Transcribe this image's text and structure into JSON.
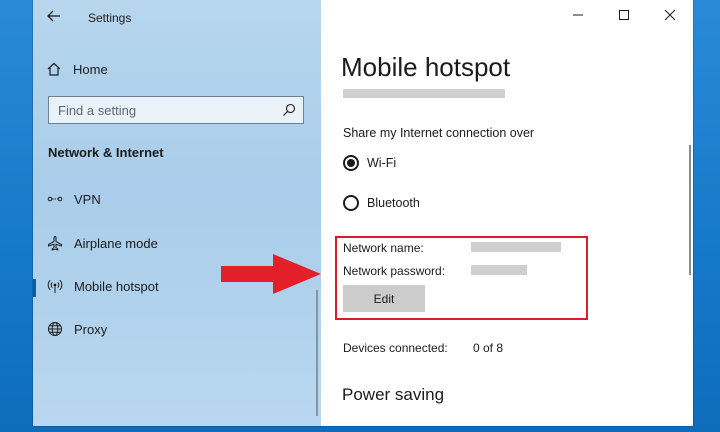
{
  "window": {
    "title": "Settings"
  },
  "sidebar": {
    "home_label": "Home",
    "search_placeholder": "Find a setting",
    "section_header": "Network & Internet",
    "items": [
      {
        "label": "VPN",
        "icon": "vpn-icon"
      },
      {
        "label": "Airplane mode",
        "icon": "airplane-icon"
      },
      {
        "label": "Mobile hotspot",
        "icon": "hotspot-icon",
        "selected": true
      },
      {
        "label": "Proxy",
        "icon": "globe-icon"
      }
    ]
  },
  "content": {
    "title": "Mobile hotspot",
    "share_label": "Share my Internet connection over",
    "radio_options": [
      {
        "label": "Wi-Fi",
        "checked": true
      },
      {
        "label": "Bluetooth",
        "checked": false
      }
    ],
    "network_name_label": "Network name:",
    "network_password_label": "Network password:",
    "edit_label": "Edit",
    "devices_label": "Devices connected:",
    "devices_value": "0 of 8",
    "power_saving_heading": "Power saving"
  },
  "colors": {
    "accent": "#0063b1",
    "highlight": "#d21f2b",
    "arrow": "#e3202a",
    "sidebar_bg": "#b0d2ec",
    "redaction": "#cfcfcf"
  }
}
